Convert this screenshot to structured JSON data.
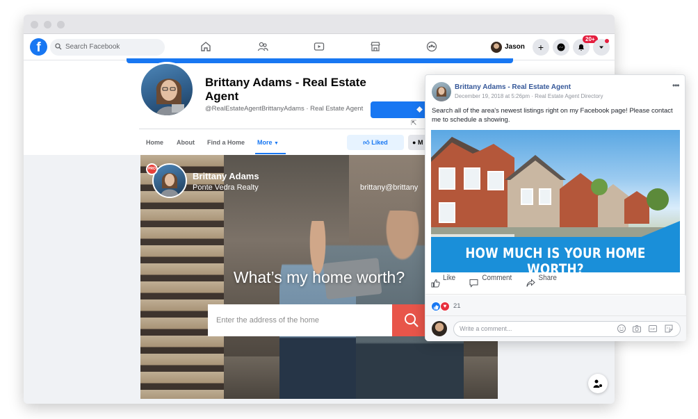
{
  "topbar": {
    "search_placeholder": "Search Facebook",
    "user_name": "Jason",
    "notification_badge": "20+",
    "logo_letter": "f"
  },
  "page": {
    "name": "Brittany Adams - Real Estate Agent",
    "handle": "@RealEstateAgentBrittanyAdams · Real Estate Agent",
    "tabs": [
      "Home",
      "About",
      "Find a Home",
      "More"
    ],
    "liked_label": "Liked",
    "message_label": "M"
  },
  "hero": {
    "agent_name": "Brittany Adams",
    "agent_company": "Ponte Vedra Realty",
    "agent_email": "brittany@brittany",
    "pro_badge": "PRO",
    "question": "What’s my home worth?",
    "address_placeholder": "Enter the address of the home"
  },
  "post": {
    "author": "Brittany Adams - Real Estate Agent",
    "meta": "December 19, 2018 at 5:26pm · Real Estate Agent Directory",
    "text": "Search all of the area's newest listings right on my Facebook page! Please contact me to schedule a showing.",
    "banner": "HOW MUCH IS YOUR HOME WORTH?",
    "actions": [
      "Like",
      "Comment",
      "Share"
    ],
    "reaction_count": "21",
    "comment_placeholder": "Write a comment...",
    "more_glyph": "•••"
  },
  "colors": {
    "facebook_blue": "#1877f2",
    "banner_blue": "#1a8fd9",
    "search_button": "#e8554a",
    "love_red": "#e8303e"
  }
}
